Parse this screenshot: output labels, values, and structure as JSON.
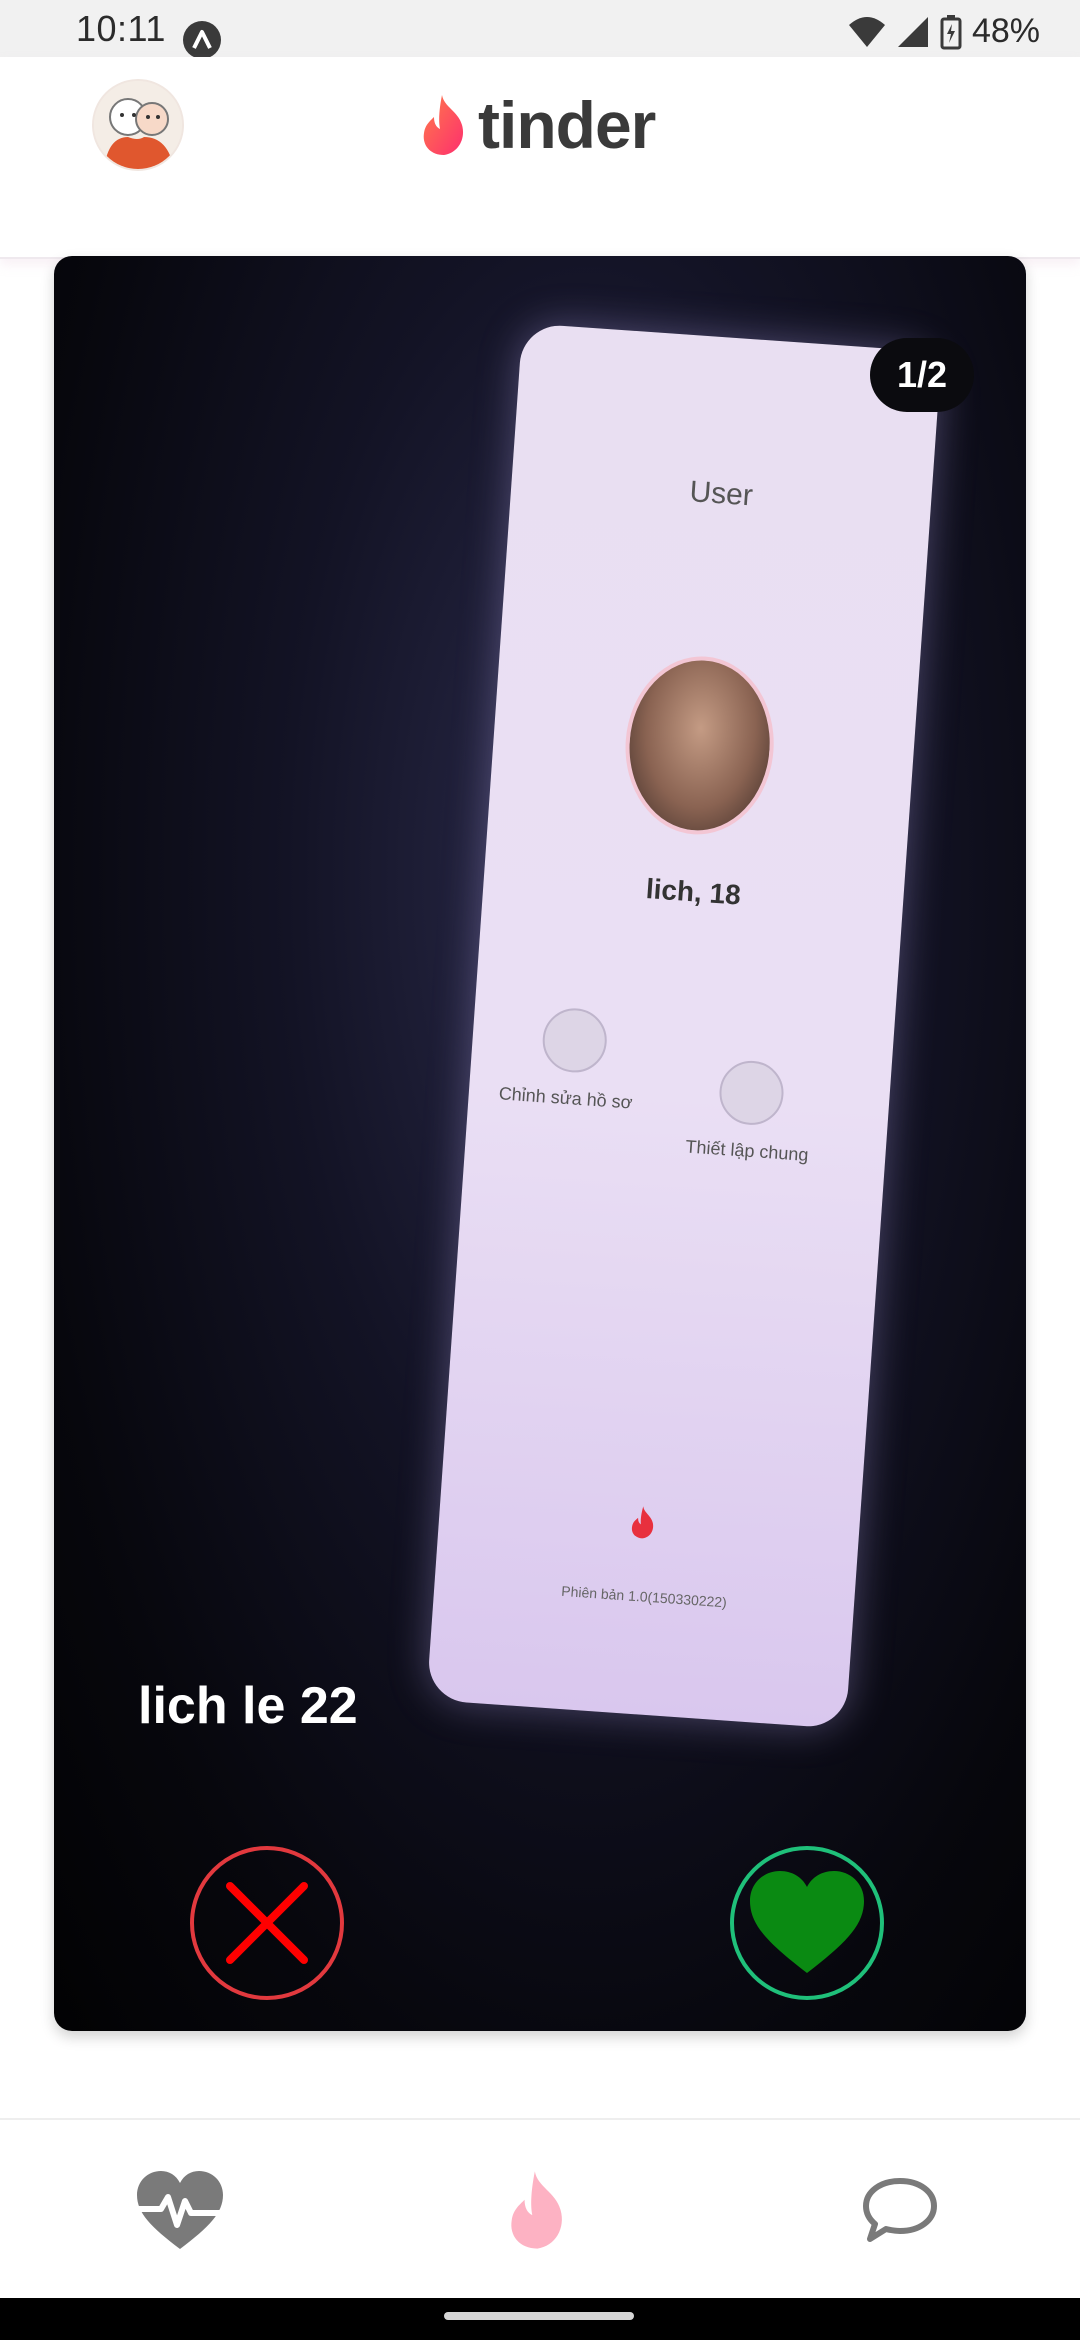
{
  "status_bar": {
    "time": "10:11",
    "battery": "48%"
  },
  "header": {
    "logo_text": "tinder",
    "brand_color": "#fd4a6a"
  },
  "card": {
    "photo_counter": "1/2",
    "profile_name": "lich le 22",
    "photo": {
      "screen_title": "User",
      "name": "lich, 18",
      "edit_label": "Chỉnh sửa hồ sơ",
      "settings_label": "Thiết lập chung",
      "footer": "Phiên bản 1.0(150330222)"
    }
  },
  "actions": {
    "nope_icon": "close-icon",
    "nope_color": "#e2393e",
    "like_icon": "heart-icon",
    "like_color": "#1fc07a",
    "like_fill": "#0a8a12"
  },
  "bottom_nav": {
    "items": [
      {
        "name": "likes",
        "icon": "heart-pulse-icon",
        "active": false
      },
      {
        "name": "swipe",
        "icon": "flame-icon",
        "active": true
      },
      {
        "name": "chat",
        "icon": "chat-bubble-icon",
        "active": false
      }
    ]
  }
}
